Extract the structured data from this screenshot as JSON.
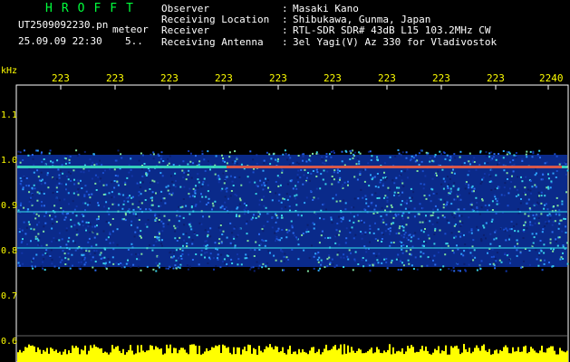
{
  "app": {
    "title": "HROFFT"
  },
  "file": {
    "name": "UT2509092230.pn",
    "suffix": "meteor"
  },
  "timestamp": {
    "date_time": "25.09.09 22:30",
    "interval": "5.."
  },
  "info": [
    {
      "label": "Observer",
      "value": "Masaki Kano"
    },
    {
      "label": "Receiving Location",
      "value": "Shibukawa, Gunma, Japan"
    },
    {
      "label": "Receiver",
      "value": "RTL-SDR SDR# 43dB L15 103.2MHz CW"
    },
    {
      "label": "Receiving Antenna",
      "value": "3el Yagi(V) Az 330 for Vladivostok"
    }
  ],
  "chart_data": {
    "type": "heatmap",
    "y_unit": "kHz",
    "y_ticks": [
      "1.1",
      "1.0",
      "0.9",
      "0.8",
      "0.7",
      "0.6"
    ],
    "ylim": [
      0.6,
      1.15
    ],
    "x_ticks": [
      "223",
      "223",
      "223",
      "223",
      "223",
      "223",
      "223",
      "223",
      "223",
      "2240"
    ],
    "signal_band": [
      0.78,
      1.0
    ],
    "traces_khz": [
      0.99,
      0.89,
      0.81
    ]
  },
  "colors": {
    "background": "#000000",
    "frame": "#ffffff",
    "labels": "#ffff00",
    "title": "#00ff3c",
    "trace": "#ff3b2f"
  }
}
